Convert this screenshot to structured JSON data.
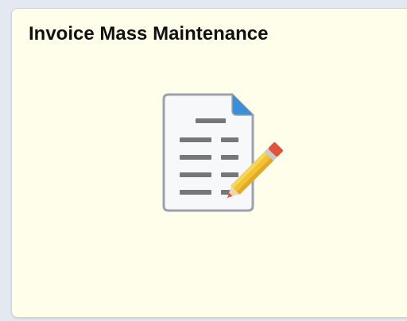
{
  "tile": {
    "title": "Invoice Mass Maintenance",
    "icon": "document-edit-icon",
    "colors": {
      "background": "#fefeeb",
      "document_border": "#9aa3ad",
      "corner_fold": "#3b8fd9",
      "text_lines": "#777777",
      "pencil_body": "#f2c233",
      "pencil_eraser": "#e0533a"
    }
  }
}
